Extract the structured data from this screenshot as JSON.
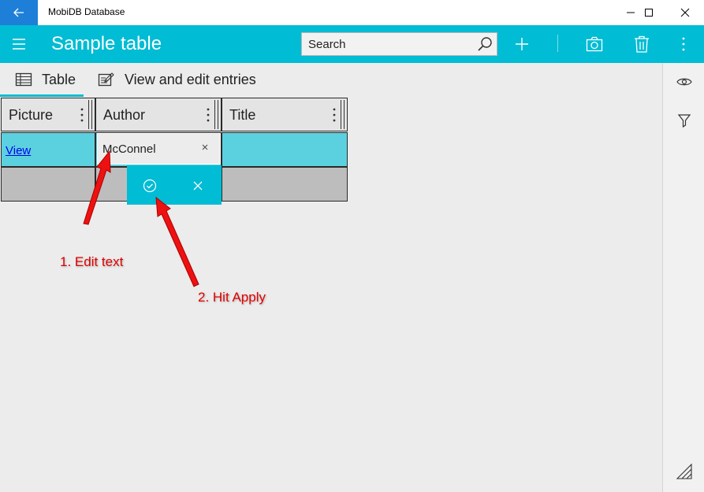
{
  "window": {
    "title": "MobiDB Database",
    "back_icon": "back-arrow-icon",
    "controls": [
      "minimize-icon",
      "maximize-icon",
      "close-icon"
    ]
  },
  "appbar": {
    "title": "Sample table",
    "search": {
      "placeholder": "Search",
      "value": ""
    },
    "actions": [
      "add-icon",
      "camera-icon",
      "delete-icon",
      "more-icon"
    ]
  },
  "tabs": [
    {
      "label": "Table",
      "icon": "table-icon",
      "selected": true
    },
    {
      "label": "View and edit entries",
      "icon": "edit-entries-icon",
      "selected": false
    }
  ],
  "table": {
    "columns": [
      "Picture",
      "Author",
      "Title"
    ],
    "rows": [
      {
        "picture_link": "View",
        "author": "McConnel",
        "title": ""
      }
    ]
  },
  "editor": {
    "value": "McConnel",
    "clear_icon": "clear-icon",
    "apply_icon": "apply-check-icon",
    "cancel_icon": "cancel-x-icon"
  },
  "side_panel": [
    "eye-icon",
    "filter-icon",
    "resize-grip-icon"
  ],
  "annotations": {
    "step1": "1. Edit text",
    "step2": "2. Hit Apply"
  },
  "colors": {
    "accent": "#00bcd4",
    "row_highlight": "#5bd1df",
    "back_button": "#1e7fd8",
    "annotation": "#e00000",
    "link": "#0000ee"
  }
}
